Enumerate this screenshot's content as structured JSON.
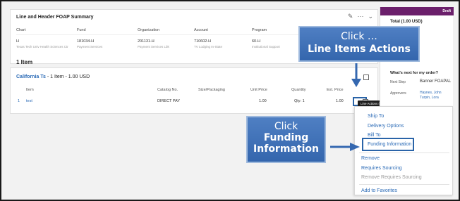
{
  "foap": {
    "title": "Line and Header FOAP Summary",
    "headers": [
      "Chart",
      "Fund",
      "Organization",
      "Account",
      "Program"
    ],
    "values": [
      "H",
      "181034-H",
      "201131-H",
      "710602-H",
      "60-H"
    ],
    "subvalues": [
      "Texas Tech Univ Health Sciences Ctr",
      "Payment Services",
      "Payment Services Lbk",
      "TV Lodging In-State",
      "Institutional Support"
    ],
    "tools": {
      "edit_icon": "pencil-icon",
      "more": "···",
      "collapse": "chevron-down-icon"
    }
  },
  "items_count": "1 Item",
  "supplier": {
    "name": "California Ts",
    "summary": " - 1 Item - 1.00 USD"
  },
  "item_columns": [
    "Item",
    "Catalog No.",
    "Size/Packaging",
    "Unit Price",
    "Quantity",
    "Ext. Price"
  ],
  "item_row": {
    "line": "1",
    "item": "test",
    "catalog": "DIRECT PAY",
    "size": "",
    "unit_price": "1.00",
    "quantity": "Qty: 1",
    "ext_price": "1.00",
    "actions": "···"
  },
  "tooltip": "Line Actions ( test )",
  "right_panel": {
    "status": "Draft",
    "total": "Total (1.00 USD)",
    "whats_next": "What's next for my order?",
    "next_step_label": "Next Step",
    "next_step_value": "Banner FOAPAL",
    "approvers_label": "Approvers",
    "approvers_line1": "Haynes, John",
    "approvers_line2": "Turpin, Lora"
  },
  "menu": {
    "ship_to": "Ship To",
    "delivery": "Delivery Options",
    "bill_to": "Bill To",
    "funding": "Funding Information",
    "remove": "Remove",
    "requires_sourcing": "Requires Sourcing",
    "remove_requires_sourcing": "Remove Requires Sourcing",
    "add_favorites": "Add to Favorites"
  },
  "callouts": {
    "line_actions": {
      "line1": "Click …",
      "line2": "Line Items  Actions"
    },
    "funding": {
      "line1": "Click",
      "line2": "Funding",
      "line3": "Information"
    }
  },
  "colors": {
    "accent_blue": "#2a64a8",
    "callout_fill": "#4472c4",
    "draft_bar": "#6b1f6b",
    "link": "#2a6ab6"
  }
}
